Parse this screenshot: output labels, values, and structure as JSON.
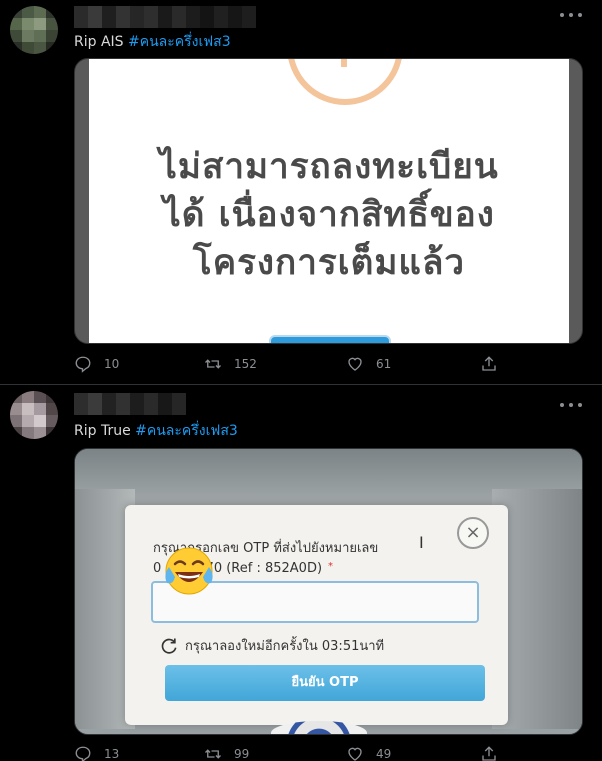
{
  "tweets": [
    {
      "text_prefix": "Rip AIS ",
      "hashtag": "#คนละครึ่งเฟส3",
      "media": {
        "message_lines": [
          "ไม่สามารถลงทะเบียน",
          "ได้ เนื่องจากสิทธิ์ของ",
          "โครงการเต็มแล้ว"
        ]
      },
      "actions": {
        "replies": "10",
        "retweets": "152",
        "likes": "61"
      }
    },
    {
      "text_prefix": "Rip True ",
      "hashtag": "#คนละครึ่งเฟส3",
      "media": {
        "line1": "กรุณากรอกเลข OTP ที่ส่งไปยังหมายเลข",
        "line2": "0",
        "line2_number": "770 (Ref : 852A0D)",
        "required_mark": "*",
        "close_symbol": "×",
        "retry_text": "กรุณาลองใหม่อีกครั้งใน 03:51นาที",
        "confirm_button": "ยืนยัน OTP",
        "emoji": "face-with-tears-of-joy"
      },
      "actions": {
        "replies": "13",
        "retweets": "99",
        "likes": "49"
      }
    }
  ],
  "colors": {
    "background": "#000000",
    "hashtag": "#1d9bf0",
    "icon_gray": "#8b8f93",
    "divider": "#2f3336"
  },
  "icons": {
    "more": "more-horizontal-icon",
    "reply": "reply-icon",
    "retweet": "retweet-icon",
    "like": "heart-icon",
    "share": "share-icon"
  }
}
